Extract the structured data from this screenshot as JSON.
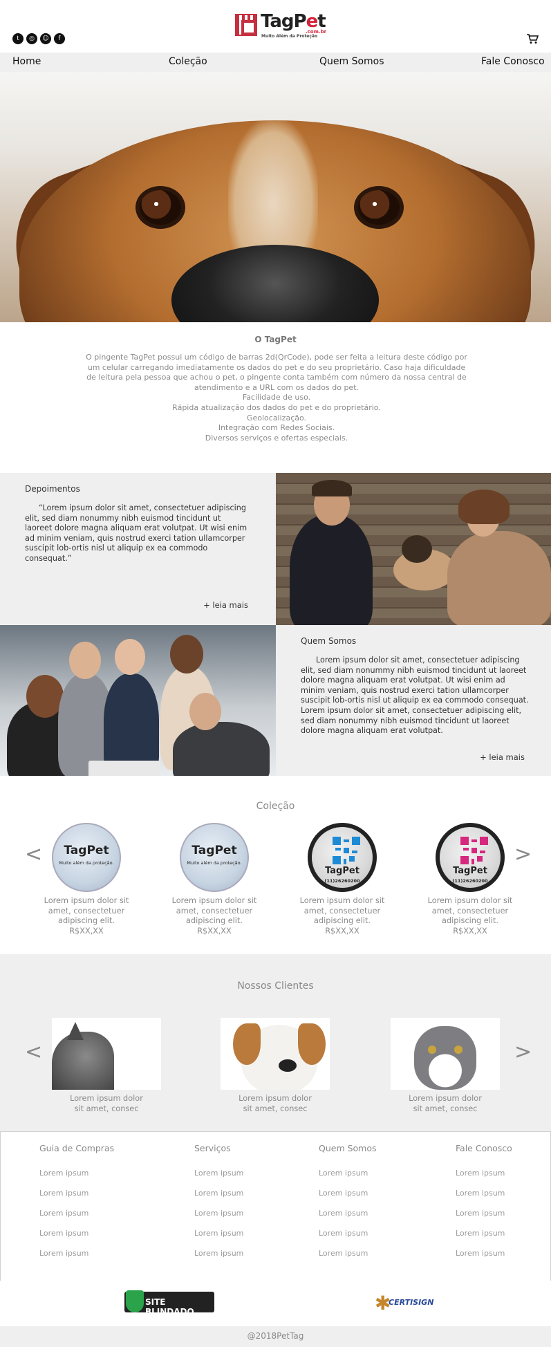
{
  "header": {
    "logo_text_a": "TagP",
    "logo_text_b": "e",
    "logo_text_c": "t",
    "logo_domain": ".com.br",
    "logo_tagline": "Muito Além da Proteção",
    "social": [
      "twitter-icon",
      "instagram-icon",
      "snapchat-icon",
      "facebook-icon"
    ],
    "social_glyphs": [
      "t",
      "◎",
      "☺",
      "f"
    ]
  },
  "nav": {
    "items": [
      "Home",
      "Coleção",
      "Quem Somos",
      "Fale Conosco"
    ]
  },
  "about": {
    "title": "O TagPet",
    "paragraph": "O pingente TagPet possui um código de barras 2d(QrCode), pode ser feita a leitura deste código por um celular carregando imediatamente os dados do pet e do seu proprietário. Caso haja dificuldade de leitura pela pessoa que achou o pet, o pingente conta também com número da nossa central de atendimento e a URL com os dados do pet.",
    "features": [
      "Facilidade de uso.",
      "Rápida atualização dos dados do pet e do proprietário.",
      "Geolocalização.",
      "Integração com Redes Sociais.",
      "Diversos serviços e ofertas especiais."
    ]
  },
  "testimonials": {
    "title": "Depoimentos",
    "text": "“Lorem ipsum dolor sit amet, consectetuer adipiscing elit, sed diam nonummy nibh euismod tincidunt ut laoreet dolore magna aliquam erat volutpat. Ut wisi enim ad minim veniam, quis nostrud exerci tation ullamcorper suscipit lob-ortis nisl ut aliquip ex ea commodo consequat.”",
    "more": "+ leia mais"
  },
  "quem_somos": {
    "title": "Quem Somos",
    "text": "Lorem ipsum dolor sit amet, consectetuer adipiscing elit, sed diam nonummy nibh euismod tincidunt ut laoreet dolore magna aliquam erat volutpat. Ut wisi enim ad minim veniam, quis nostrud exerci tation ullamcorper suscipit lob-ortis nisl ut aliquip ex ea commodo consequat. Lorem ipsum dolor sit amet, consectetuer adipiscing elit, sed diam nonummy nibh euismod tincidunt ut laoreet dolore magna aliquam erat volutpat.",
    "more": "+ leia mais"
  },
  "colecao": {
    "title": "Coleção",
    "arrow_prev": "<",
    "arrow_next": ">",
    "products": [
      {
        "tag_title": "TagPet",
        "tag_sub": "Muito além da proteção.",
        "desc": "Lorem ipsum dolor sit amet, consectetuer adipiscing elit.",
        "price": "R$XX,XX",
        "style": "plain",
        "qr_color": ""
      },
      {
        "tag_title": "TagPet",
        "tag_sub": "Muito além da proteção.",
        "desc": "Lorem ipsum dolor sit amet, consectetuer adipiscing elit.",
        "price": "R$XX,XX",
        "style": "plain",
        "qr_color": ""
      },
      {
        "tag_title": "TagPet",
        "tag_sub": "(11)26260200",
        "desc": "Lorem ipsum dolor sit amet, consectetuer adipiscing elit.",
        "price": "R$XX,XX",
        "style": "qr",
        "qr_color": "#1e8ad6"
      },
      {
        "tag_title": "TagPet",
        "tag_sub": "(11)26260200",
        "desc": "Lorem ipsum dolor sit amet, consectetuer adipiscing elit.",
        "price": "R$XX,XX",
        "style": "qr",
        "qr_color": "#d6287e"
      }
    ]
  },
  "clientes": {
    "title": "Nossos Clientes",
    "arrow_prev": "<",
    "arrow_next": ">",
    "items": [
      {
        "caption": "Lorem ipsum dolor sit amet, consec",
        "animal": "gray-cat"
      },
      {
        "caption": "Lorem ipsum dolor sit amet, consec",
        "animal": "white-dog"
      },
      {
        "caption": "Lorem ipsum dolor sit amet, consec",
        "animal": "kitten"
      }
    ]
  },
  "footer": {
    "columns": [
      {
        "title": "Guia de Compras",
        "links": [
          "Lorem ipsum",
          "Lorem ipsum",
          "Lorem ipsum",
          "Lorem ipsum",
          "Lorem ipsum"
        ]
      },
      {
        "title": "Serviços",
        "links": [
          "Lorem ipsum",
          "Lorem ipsum",
          "Lorem ipsum",
          "Lorem ipsum",
          "Lorem ipsum"
        ]
      },
      {
        "title": "Quem Somos",
        "links": [
          "Lorem ipsum",
          "Lorem ipsum",
          "Lorem ipsum",
          "Lorem ipsum",
          "Lorem ipsum"
        ]
      },
      {
        "title": "Fale Conosco",
        "links": [
          "Lorem ipsum",
          "Lorem ipsum",
          "Lorem ipsum",
          "Lorem ipsum",
          "Lorem ipsum"
        ]
      }
    ],
    "seal_1": "SITE BLINDADO",
    "seal_2": "CERTISIGN",
    "copyright": "@2018PetTag"
  },
  "colors": {
    "brand_red": "#d4213a",
    "gray_bg": "#efefef",
    "muted_text": "#8a8a8a"
  }
}
